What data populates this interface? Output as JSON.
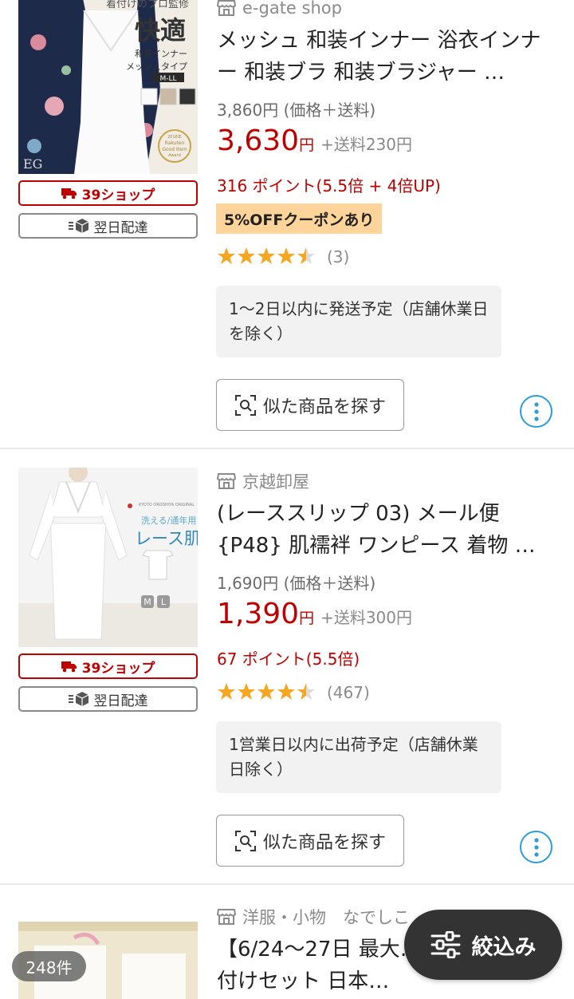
{
  "items": [
    {
      "shop": "e-gate shop",
      "title": "メッシュ 和装インナー 浴衣インナー 和装ブラ 和装ブラジャー …",
      "list_price": "3,860円 (価格＋送料)",
      "price": "3,630",
      "yen": "円",
      "shipping": "+送料230円",
      "points": "316 ポイント(5.5倍 + 4倍UP)",
      "coupon": "5%OFFクーポンあり",
      "rating": 4.5,
      "review_count": "(3)",
      "delivery_note": "1〜2日以内に発送予定（店舗休業日を除く）",
      "badge_39": "39ショップ",
      "badge_nextday": "翌日配達",
      "similar_label": "似た商品を探す",
      "thumb": {
        "top_text": "着付けのプロ監修",
        "main_text": "快適",
        "sub_text_1": "和装インナー",
        "sub_text_2": "メッシュタイプ",
        "size_text": "M-LL",
        "award_text_1": "2016年",
        "award_text_2": "Rakuten",
        "award_text_3": "Good Item",
        "award_text_4": "Award",
        "logo_text": "EG"
      }
    },
    {
      "shop": "京越卸屋",
      "title": "(レーススリップ 03) メール便 {P48} 肌襦袢 ワンピース 着物 …",
      "list_price": "1,690円 (価格＋送料)",
      "price": "1,390",
      "yen": "円",
      "shipping": "+送料300円",
      "points": "67 ポイント(5.5倍)",
      "rating": 4.5,
      "review_count": "(467)",
      "delivery_note": "1営業日以内に出荷予定（店舗休業日除く）",
      "badge_39": "39ショップ",
      "badge_nextday": "翌日配達",
      "similar_label": "似た商品を探す",
      "thumb": {
        "brand_text": "KYOTO OROSHIYA ORIGINAL",
        "small_text": "洗える/通年用",
        "main_text": "レース肌着",
        "size_m": "M",
        "size_l": "L"
      }
    },
    {
      "shop": "洋服・小物　なでしこ",
      "title": "【6/24〜27日 最大…ポン】浴衣 着付けセット 日本…"
    }
  ],
  "result_count": "248件",
  "filter_label": "絞込み",
  "colors": {
    "accent_red": "#bf0000",
    "star": "#f5a623",
    "coupon_bg": "#ffd49a",
    "more_blue": "#2d9cdb"
  }
}
